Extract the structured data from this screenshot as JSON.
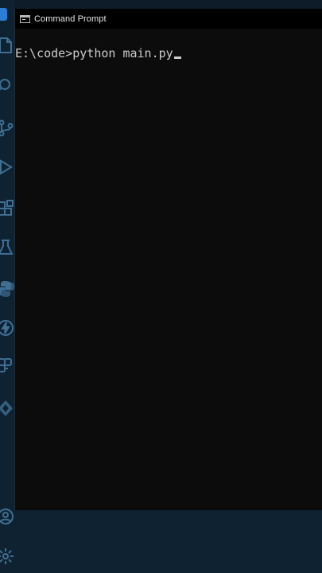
{
  "window": {
    "title": "Command Prompt"
  },
  "console": {
    "prompt": "E:\\code>",
    "command": "python main.py"
  },
  "activity_bar": {
    "icons": [
      "app-logo-icon",
      "files-icon",
      "search-icon",
      "source-control-icon",
      "run-debug-icon",
      "extensions-icon",
      "testing-icon",
      "python-icon",
      "lightning-icon",
      "cloud-icon",
      "deploy-icon",
      "account-icon",
      "settings-gear-icon"
    ]
  },
  "colors": {
    "console_bg": "#0c0c0c",
    "console_text": "#cccccc",
    "titlebar_bg": "#000000",
    "sidebar_bg": "#0f2232",
    "icon_color": "#3f6f93"
  }
}
